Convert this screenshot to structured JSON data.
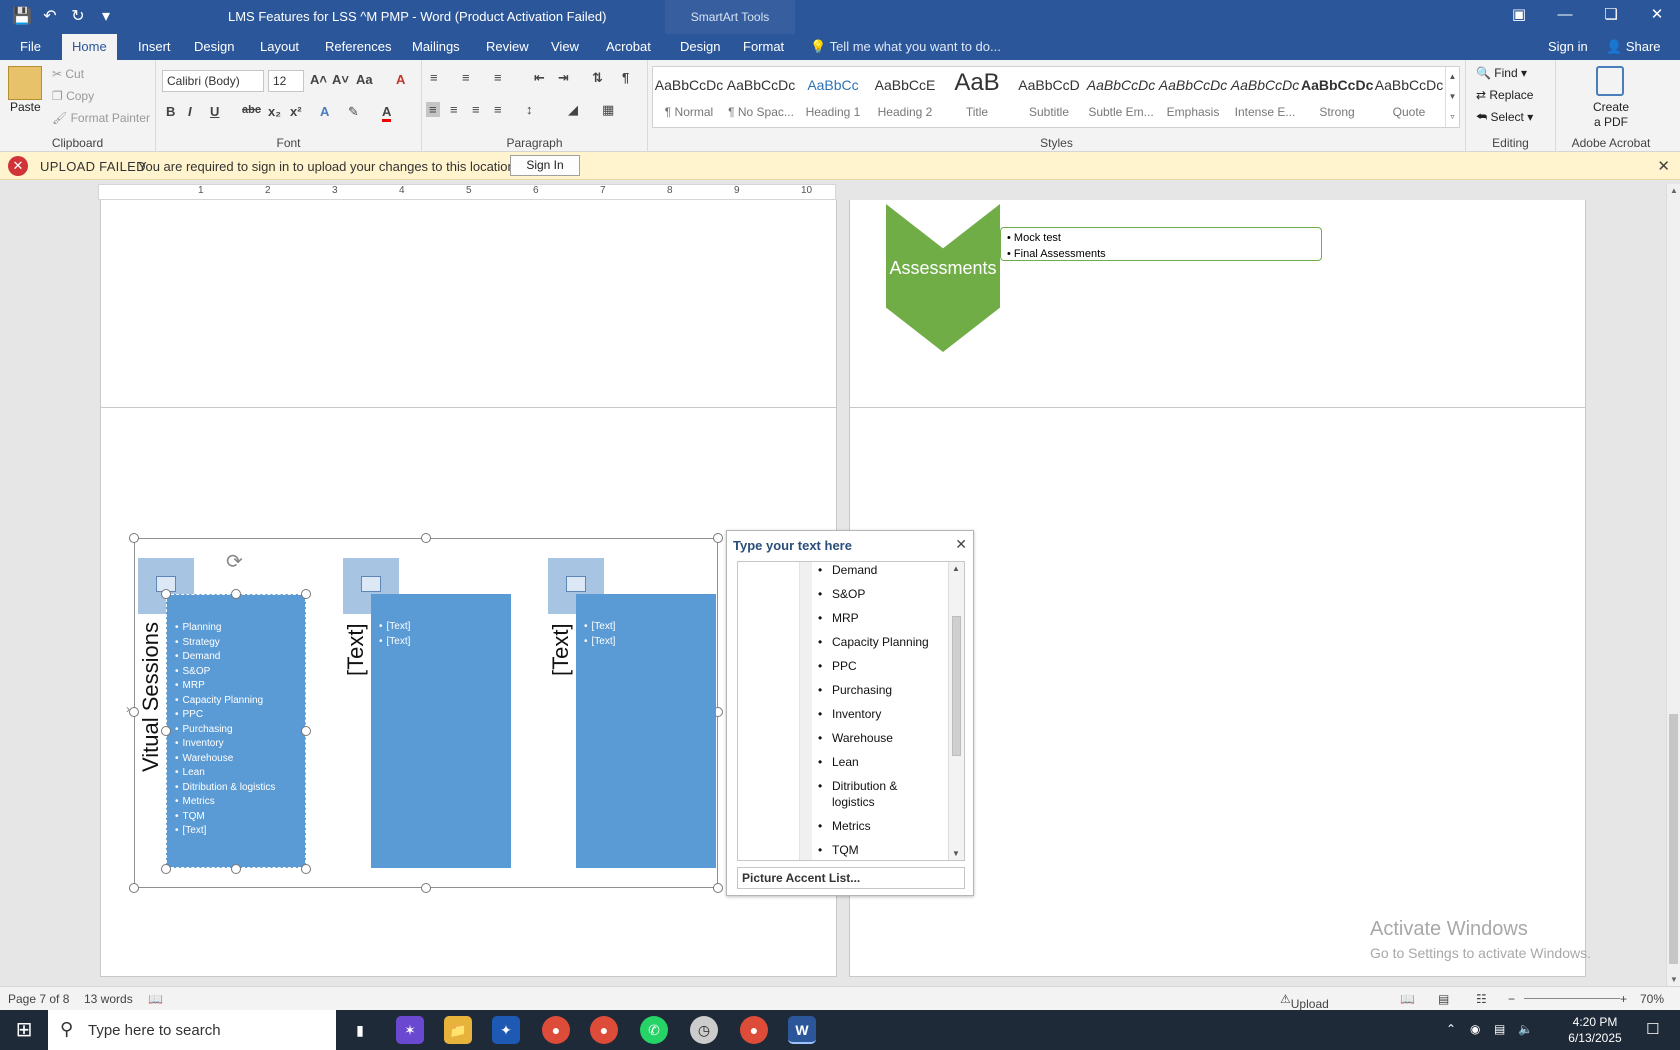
{
  "titlebar": {
    "doc_title": "LMS Features for LSS ^M PMP - Word (Product Activation Failed)",
    "smartart_tools": "SmartArt Tools"
  },
  "tabs": {
    "file": "File",
    "home": "Home",
    "insert": "Insert",
    "design": "Design",
    "layout": "Layout",
    "references": "References",
    "mailings": "Mailings",
    "review": "Review",
    "view": "View",
    "acrobat": "Acrobat",
    "sa_design": "Design",
    "sa_format": "Format",
    "tell_me": "Tell me what you want to do...",
    "sign_in": "Sign in",
    "share": "Share"
  },
  "ribbon": {
    "clipboard": {
      "paste": "Paste",
      "cut": "Cut",
      "copy": "Copy",
      "format_painter": "Format Painter",
      "label": "Clipboard"
    },
    "font": {
      "name": "Calibri (Body)",
      "size": "12",
      "label": "Font"
    },
    "paragraph": {
      "label": "Paragraph"
    },
    "styles": {
      "label": "Styles",
      "items": [
        {
          "sample": "AaBbCcDc",
          "name": "¶ Normal"
        },
        {
          "sample": "AaBbCcDc",
          "name": "¶ No Spac..."
        },
        {
          "sample": "AaBbCc",
          "name": "Heading 1"
        },
        {
          "sample": "AaBbCcE",
          "name": "Heading 2"
        },
        {
          "sample": "AaB",
          "name": "Title"
        },
        {
          "sample": "AaBbCcD",
          "name": "Subtitle"
        },
        {
          "sample": "AaBbCcDc",
          "name": "Subtle Em..."
        },
        {
          "sample": "AaBbCcDc",
          "name": "Emphasis"
        },
        {
          "sample": "AaBbCcDc",
          "name": "Intense E..."
        },
        {
          "sample": "AaBbCcDc",
          "name": "Strong"
        },
        {
          "sample": "AaBbCcDc",
          "name": "Quote"
        }
      ]
    },
    "editing": {
      "find": "Find",
      "replace": "Replace",
      "select": "Select",
      "label": "Editing"
    },
    "acrobat": {
      "create_pdf_1": "Create",
      "create_pdf_2": "a PDF",
      "label": "Adobe Acrobat"
    }
  },
  "message_bar": {
    "title": "UPLOAD FAILED",
    "text": "You are required to sign in to upload your changes to this location.",
    "button": "Sign In"
  },
  "document": {
    "assessments": {
      "label": "Assessments",
      "bullets": [
        "Mock test",
        "Final Assessments"
      ]
    },
    "smartart": {
      "col1_label": "Vitual Sessions",
      "col1_items": [
        "Planning",
        "Strategy",
        "Demand",
        "S&OP",
        "MRP",
        "Capacity Planning",
        "PPC",
        "Purchasing",
        "Inventory",
        "Warehouse",
        "Lean",
        "Ditribution & logistics",
        "Metrics",
        "TQM",
        "[Text]"
      ],
      "col2_label": "[Text]",
      "col2_items": [
        "[Text]",
        "[Text]"
      ],
      "col3_label": "[Text]",
      "col3_items": [
        "[Text]",
        "[Text]"
      ]
    }
  },
  "text_pane": {
    "title": "Type your text here",
    "items": [
      "Demand",
      "S&OP",
      "MRP",
      "Capacity Planning",
      "PPC",
      "Purchasing",
      "Inventory",
      "Warehouse",
      "Lean",
      "Ditribution & logistics",
      "Metrics",
      "TQM"
    ],
    "footer": "Picture Accent List..."
  },
  "watermark": {
    "line1": "Activate Windows",
    "line2": "Go to Settings to activate Windows."
  },
  "statusbar": {
    "page": "Page 7 of 8",
    "words": "13 words",
    "upload": "Upload Failed",
    "zoom": "70%"
  },
  "taskbar": {
    "search_placeholder": "Type here to search",
    "time": "4:20 PM",
    "date": "6/13/2025"
  },
  "ruler_numbers": [
    "1",
    "2",
    "3",
    "4",
    "5",
    "6",
    "7",
    "8",
    "9",
    "10"
  ]
}
